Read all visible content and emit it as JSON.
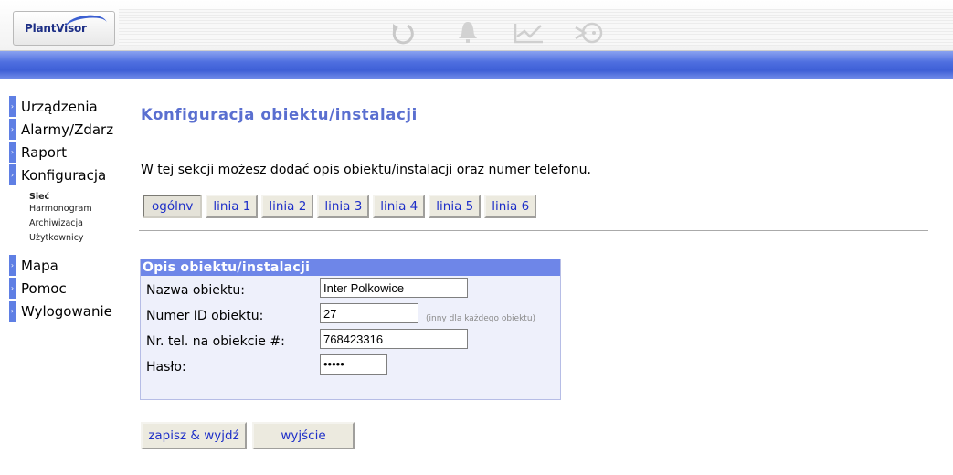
{
  "app": {
    "logo_text": "PlantVisor"
  },
  "toolbar": {
    "icons": [
      "refresh-icon",
      "alarm-bell-icon",
      "trend-chart-icon",
      "service-icon"
    ]
  },
  "sidebar": {
    "items": [
      {
        "label": "Urządzenia"
      },
      {
        "label": "Alarmy/Zdarz"
      },
      {
        "label": "Raport"
      },
      {
        "label": "Konfiguracja"
      }
    ],
    "subitems": [
      {
        "label": "Sieć",
        "active": true
      },
      {
        "label": "Harmonogram"
      },
      {
        "label": "Archiwizacja"
      },
      {
        "label": "Użytkownicy"
      }
    ],
    "items_after": [
      {
        "label": "Mapa"
      },
      {
        "label": "Pomoc"
      },
      {
        "label": "Wylogowanie"
      }
    ]
  },
  "main": {
    "title": "Konfiguracja obiektu/instalacji",
    "description": "W tej sekcji możesz dodać opis obiektu/instalacji oraz numer telefonu.",
    "tabs": [
      {
        "label": "ogólnv",
        "active": true
      },
      {
        "label": "linia 1"
      },
      {
        "label": "linia 2"
      },
      {
        "label": "linia 3"
      },
      {
        "label": "linia 4"
      },
      {
        "label": "linia 5"
      },
      {
        "label": "linia 6"
      }
    ],
    "form": {
      "heading": "Opis obiektu/instalacji",
      "name_label": "Nazwa obiektu:",
      "name_value": "Inter Polkowice",
      "id_label": "Numer ID obiektu:",
      "id_value": "27",
      "id_hint": "(inny dla każdego obiektu)",
      "phone_label": "Nr. tel. na obiekcie #:",
      "phone_value": "768423316",
      "password_label": "Hasło:",
      "password_value": "•••••"
    },
    "buttons": {
      "save_exit": "zapisz & wyjdź",
      "exit": "wyjście"
    }
  },
  "colors": {
    "accent": "#5f7fe4",
    "title": "#5a6fd0",
    "link": "#1e2fc8",
    "panel_bg": "#eef0fb",
    "panel_head": "#6e86e8"
  }
}
